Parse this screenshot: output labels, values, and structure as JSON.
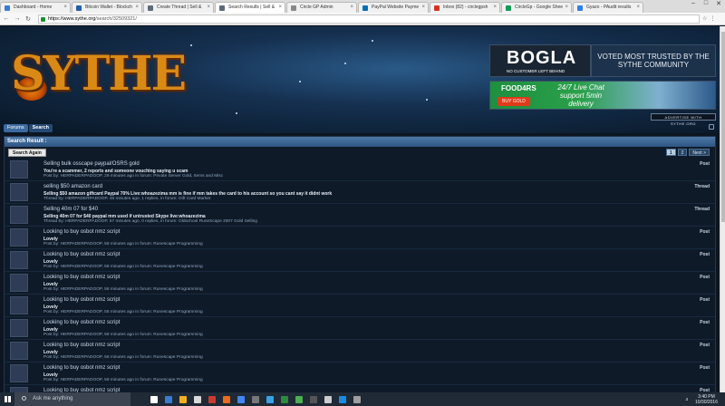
{
  "browser": {
    "tabs": [
      {
        "label": "Dashboard - Home",
        "color": "#3a7bd5"
      },
      {
        "label": "Bitcoin Wallet - Blockch",
        "color": "#1f5fa8"
      },
      {
        "label": "Create Thread | Sell &",
        "color": "#5b6b7a"
      },
      {
        "label": "Search Results | Sell &",
        "color": "#5b6b7a",
        "active": true
      },
      {
        "label": "Circle GP Admin",
        "color": "#888888"
      },
      {
        "label": "PayPal Website Payme",
        "color": "#0070ba"
      },
      {
        "label": "Inbox (82) - circlegpsh",
        "color": "#d93025"
      },
      {
        "label": "CircleGp - Google Shee",
        "color": "#0f9d58"
      },
      {
        "label": "Gyazo - PAudit results",
        "color": "#2f80ed"
      }
    ],
    "url_host": "https://www.sythe.org",
    "url_path": "/search/32509321/"
  },
  "header": {
    "logo": "SYTHE",
    "bogla_name": "BOGLA",
    "bogla_tag": "NO CUSTOMER LEFT BEHIND",
    "voted": "VOTED MOST TRUSTED BY THE SYTHE COMMUNITY",
    "foodgrs": "FOOD4RS",
    "buy_gold": "BUY GOLD",
    "live_chat": "24/7 Live Chat support 5min delivery",
    "advertise": "ADVERTISE WITH SYTHE.ORG"
  },
  "breadcrumb": {
    "forums": "Forums",
    "current": "Search"
  },
  "results": {
    "title": "Search Result :",
    "search_again": "Search Again",
    "pages": [
      "1",
      "2",
      "Next >"
    ],
    "items": [
      {
        "title": "Selling bulk osscape paypal/OSRS gold",
        "snippet": "You're a scammer, 2 reports and someone vouching saying u scam",
        "meta": "Post by: HERPADERPADOOP, 29 minutes ago in forum: Private Server Gold, Items and Misc",
        "kind": "Post"
      },
      {
        "title": "selling $50 amazon card",
        "snippet": "Selling $50 amazon giftcard Paypal 70% Live:whoazezima mm is fine if mm takes the card to his account so you cant say it didnt work",
        "meta": "Thread by: HERPADERPADOOP, 46 minutes ago, 1 replies, in forum: Gift Card Market",
        "kind": "Thread"
      },
      {
        "title": "Selling 40m 07 for $40",
        "snippet": "Selling 40m 07 for $40 paypal mm used if untrusted Skype live:whoazezima",
        "meta": "Thread by: HERPADERPADOOP, 57 minutes ago, 0 replies, in forum: Oldschool RuneScape 2007 Gold Selling",
        "kind": "Thread"
      },
      {
        "title": "Looking to buy osbot nmz script",
        "snippet": "Lovely",
        "meta": "Post by: HERPADERPADOOP, 58 minutes ago in forum: Runescape Programming",
        "kind": "Post"
      },
      {
        "title": "Looking to buy osbot nmz script",
        "snippet": "Lovely",
        "meta": "Post by: HERPADERPADOOP, 58 minutes ago in forum: Runescape Programming",
        "kind": "Post"
      },
      {
        "title": "Looking to buy osbot nmz script",
        "snippet": "Lovely",
        "meta": "Post by: HERPADERPADOOP, 58 minutes ago in forum: Runescape Programming",
        "kind": "Post"
      },
      {
        "title": "Looking to buy osbot nmz script",
        "snippet": "Lovely",
        "meta": "Post by: HERPADERPADOOP, 58 minutes ago in forum: Runescape Programming",
        "kind": "Post"
      },
      {
        "title": "Looking to buy osbot nmz script",
        "snippet": "Lovely",
        "meta": "Post by: HERPADERPADOOP, 58 minutes ago in forum: Runescape Programming",
        "kind": "Post"
      },
      {
        "title": "Looking to buy osbot nmz script",
        "snippet": "Lovely",
        "meta": "Post by: HERPADERPADOOP, 58 minutes ago in forum: Runescape Programming",
        "kind": "Post"
      },
      {
        "title": "Looking to buy osbot nmz script",
        "snippet": "Lovely",
        "meta": "Post by: HERPADERPADOOP, 58 minutes ago in forum: Runescape Programming",
        "kind": "Post"
      },
      {
        "title": "Looking to buy osbot nmz script",
        "snippet": "Lovely",
        "meta": "Post by: HERPADERPADOOP, 58 minutes ago in forum: Runescape Programming",
        "kind": "Post"
      }
    ]
  },
  "taskbar": {
    "search_placeholder": "Ask me anything",
    "time": "3:40 PM",
    "date": "10/30/2016",
    "icon_colors": [
      "#ffffff",
      "#3a7bd5",
      "#f2b01e",
      "#d9d9d9",
      "#cc3b2b",
      "#e86b1f",
      "#4285f4",
      "#777777",
      "#3aa0e8",
      "#2b8a3e",
      "#4caf50",
      "#555555",
      "#cccccc",
      "#1e88e5",
      "#9e9e9e"
    ]
  }
}
